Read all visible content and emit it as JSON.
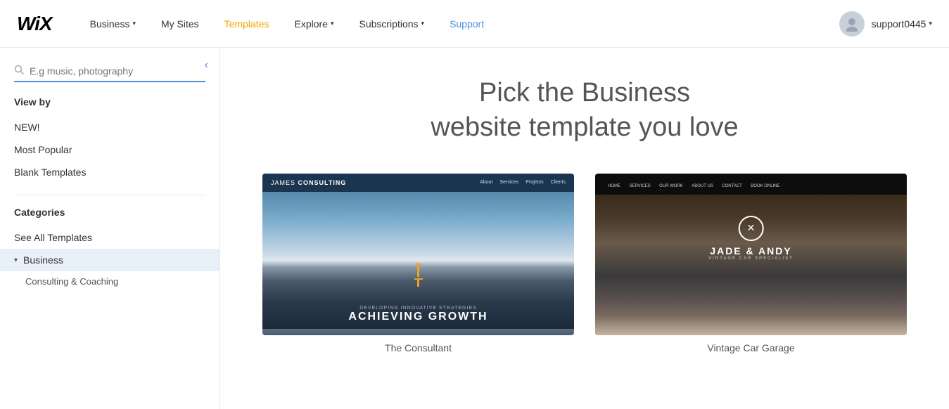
{
  "header": {
    "logo": "WiX",
    "nav": [
      {
        "label": "Business",
        "hasArrow": true,
        "color": "normal"
      },
      {
        "label": "My Sites",
        "hasArrow": false,
        "color": "normal"
      },
      {
        "label": "Templates",
        "hasArrow": false,
        "color": "yellow"
      },
      {
        "label": "Explore",
        "hasArrow": true,
        "color": "normal"
      },
      {
        "label": "Subscriptions",
        "hasArrow": true,
        "color": "normal"
      },
      {
        "label": "Support",
        "hasArrow": false,
        "color": "blue"
      }
    ],
    "user": {
      "username": "support0445",
      "hasArrow": true
    }
  },
  "sidebar": {
    "collapse_icon": "‹",
    "search_placeholder": "E.g music, photography",
    "view_by_label": "View by",
    "view_items": [
      {
        "label": "NEW!"
      },
      {
        "label": "Most Popular"
      },
      {
        "label": "Blank Templates"
      }
    ],
    "categories_label": "Categories",
    "category_items": [
      {
        "label": "See All Templates",
        "active": false
      },
      {
        "label": "Business",
        "active": true
      },
      {
        "label": "Consulting & Coaching",
        "sub": true
      }
    ]
  },
  "main": {
    "title_line1": "Pick the Business",
    "title_line2": "website template you love",
    "templates": [
      {
        "id": "consultant",
        "label": "The Consultant",
        "thumb_type": "1",
        "thumb1": {
          "brand": "JAMES CONSULTING",
          "nav_items": [
            "About",
            "Services",
            "Projects",
            "Clients"
          ],
          "sub_text": "DEVELOPING INNOVATIVE STRATEGIES",
          "main_text": "ACHIEVING GROWTH"
        }
      },
      {
        "id": "vintage-car",
        "label": "Vintage Car Garage",
        "thumb_type": "2",
        "thumb2": {
          "brand": "JADE & ANDY",
          "sub_text": "VINTAGE CAR SPECIALIST",
          "nav_items": [
            "HOME",
            "SERVICES",
            "OUR WORK",
            "ABOUT US",
            "CONTACT",
            "BOOK ONLINE"
          ]
        }
      }
    ]
  }
}
